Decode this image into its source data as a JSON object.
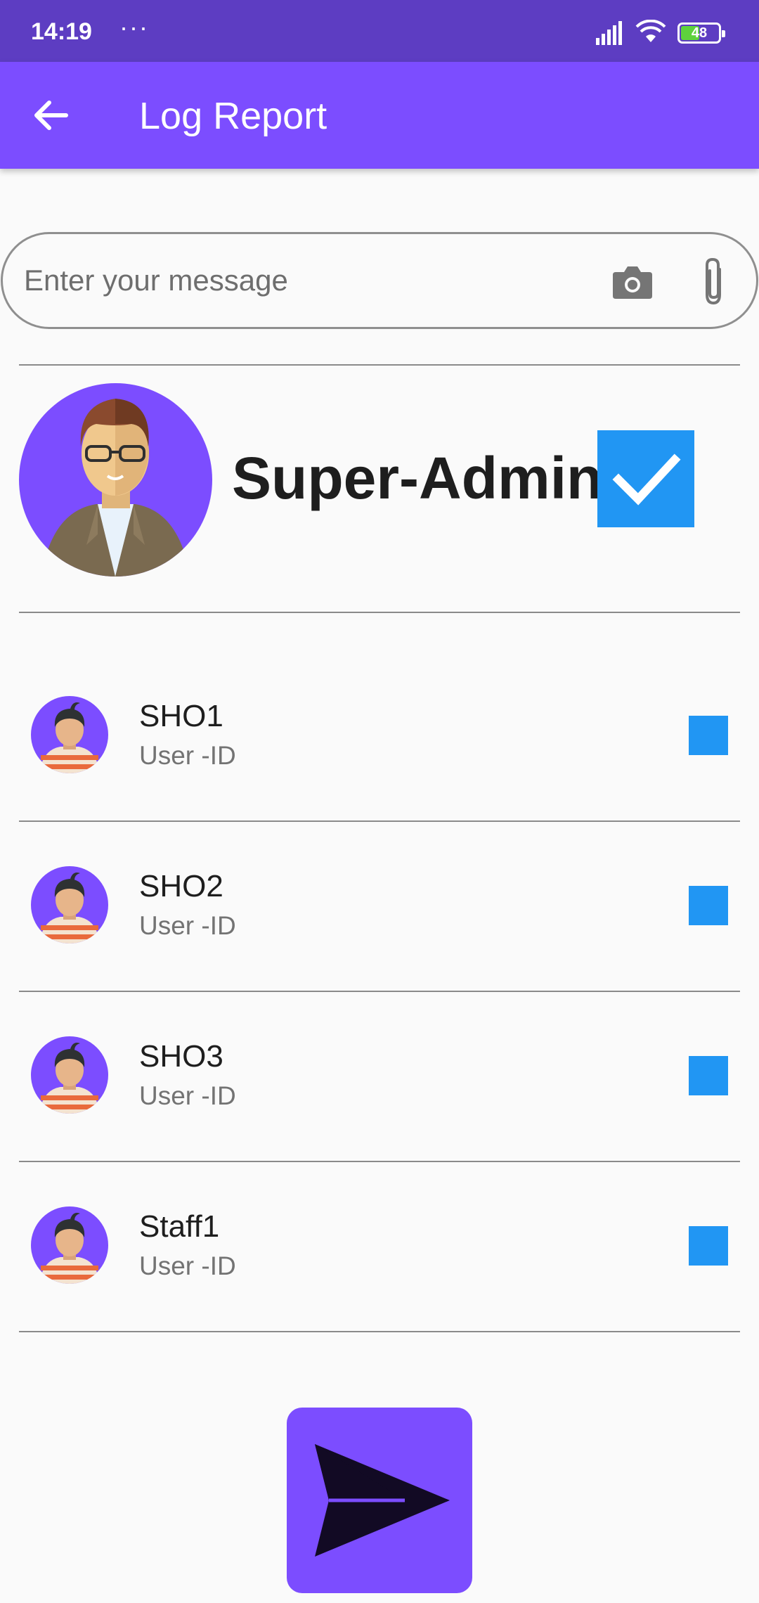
{
  "status_bar": {
    "time": "14:19",
    "more_indicator": "···",
    "battery_level": "48",
    "icons": [
      "signal-icon",
      "wifi-icon",
      "battery-icon"
    ]
  },
  "app_bar": {
    "title": "Log Report",
    "back_icon": "arrow-back-icon"
  },
  "message": {
    "placeholder": "Enter your message",
    "value": "",
    "icons": [
      "camera-icon",
      "paperclip-icon"
    ]
  },
  "admin": {
    "name": "Super-Admin",
    "checked": true
  },
  "users": [
    {
      "name": "SHO1",
      "subtitle": "User -ID",
      "checked": false
    },
    {
      "name": "SHO2",
      "subtitle": "User -ID",
      "checked": false
    },
    {
      "name": "SHO3",
      "subtitle": "User -ID",
      "checked": false
    },
    {
      "name": "Staff1",
      "subtitle": "User -ID",
      "checked": false
    }
  ],
  "send_button": {
    "icon": "send-icon"
  },
  "colors": {
    "status_bar": "#5d3dc2",
    "primary": "#7c4dff",
    "checkbox": "#2196f3",
    "background": "#fafafa"
  }
}
